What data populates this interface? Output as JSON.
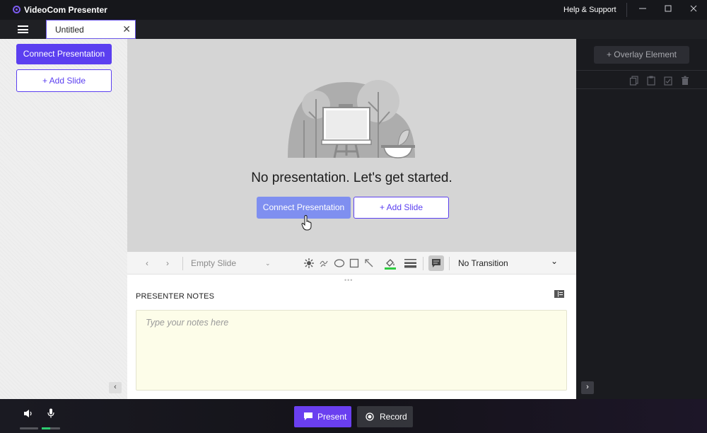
{
  "app": {
    "title": "VideoCom Presenter",
    "help_label": "Help & Support"
  },
  "document_tab": {
    "name": "Untitled"
  },
  "left_panel": {
    "connect_label": "Connect Presentation",
    "add_slide_label": "+ Add Slide"
  },
  "slide_area": {
    "empty_message": "No presentation. Let's get started.",
    "connect_label": "Connect Presentation",
    "add_slide_label": "+ Add Slide"
  },
  "toolbar": {
    "layout_value": "Empty Slide",
    "transition_value": "No Transition"
  },
  "notes": {
    "title": "PRESENTER NOTES",
    "placeholder": "Type your notes here"
  },
  "right_panel": {
    "overlay_label": "+ Overlay Element"
  },
  "bottom_bar": {
    "present_label": "Present",
    "record_label": "Record"
  },
  "colors": {
    "accent": "#5b3ff0",
    "present": "#6a3ff0",
    "mic_level": "#2ecc71"
  }
}
